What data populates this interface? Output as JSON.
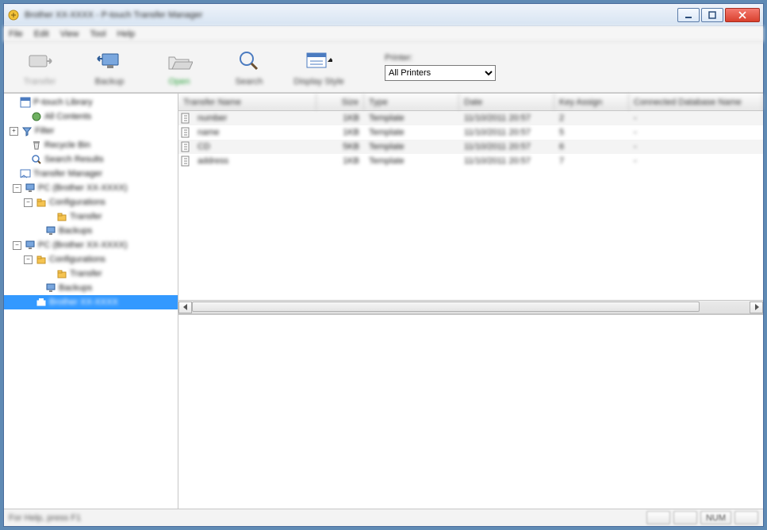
{
  "window": {
    "title": "Brother XX-XXXX - P-touch Transfer Manager"
  },
  "menus": {
    "file": "File",
    "edit": "Edit",
    "view": "View",
    "tool": "Tool",
    "help": "Help"
  },
  "toolbar": {
    "transfer": "Transfer",
    "backup": "Backup",
    "open": "Open",
    "search": "Search",
    "display": "Display Style",
    "printer_label": "Printer:",
    "printer_value": "All Printers"
  },
  "tree": {
    "library": "P-touch Library",
    "all": "All Contents",
    "filter": "Filter",
    "recycle": "Recycle Bin",
    "searchres": "Search Results",
    "transfer_mgr": "Transfer Manager",
    "pc1": "PC (Brother XX-XXXX)",
    "config": "Configurations",
    "transfer": "Transfer",
    "backups": "Backups",
    "pc2": "PC (Brother XX-XXXX)",
    "selected": "Brother XX-XXXX"
  },
  "columns": {
    "name": "Transfer Name",
    "size": "Size",
    "type": "Type",
    "date": "Date",
    "key": "Key Assign",
    "db": "Connected Database Name"
  },
  "rows": [
    {
      "name": "number",
      "size": "1KB",
      "type": "Template",
      "date": "11/10/2011 20:57",
      "key": "2",
      "db": "-"
    },
    {
      "name": "name",
      "size": "1KB",
      "type": "Template",
      "date": "11/10/2011 20:57",
      "key": "5",
      "db": "-"
    },
    {
      "name": "CD",
      "size": "5KB",
      "type": "Template",
      "date": "11/10/2011 20:57",
      "key": "6",
      "db": "-"
    },
    {
      "name": "address",
      "size": "1KB",
      "type": "Template",
      "date": "11/10/2011 20:57",
      "key": "7",
      "db": "-"
    }
  ],
  "status": {
    "help": "For Help, press F1",
    "num": "NUM"
  }
}
